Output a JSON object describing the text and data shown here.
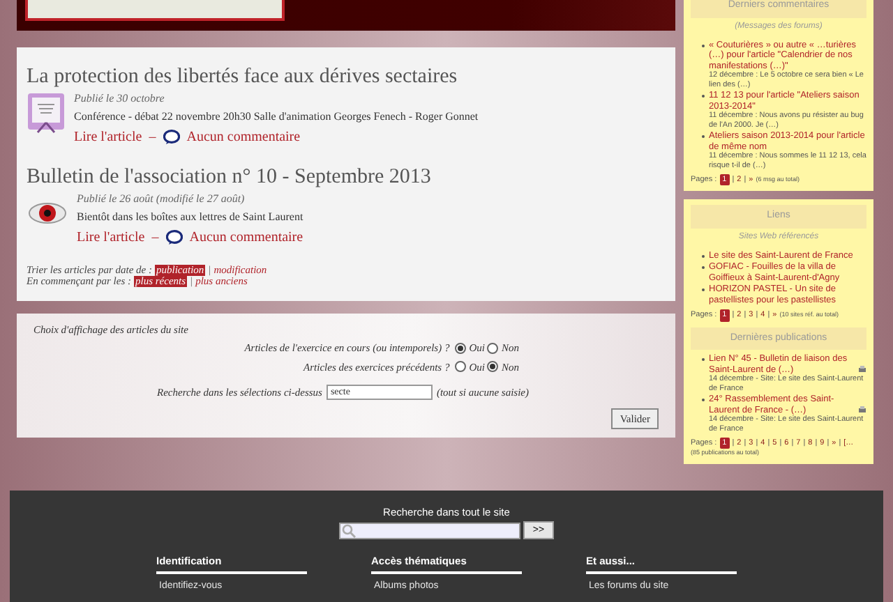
{
  "articles": [
    {
      "title": "La protection des libertés face aux dérives sectaires",
      "date": "Publié le 30 octobre",
      "summary": "Conférence - débat 22 novembre 20h30 Salle d'animation Georges Fenech - Roger Gonnet",
      "read": "Lire l'article",
      "dash": "–",
      "comments": "Aucun commentaire",
      "kind": "poster"
    },
    {
      "title": "Bulletin de l'association n° 10 - Septembre 2013",
      "date": "Publié le 26 août (modifié le 27 août)",
      "summary": "Bientôt dans les boîtes aux lettres de Saint Laurent",
      "read": "Lire l'article",
      "dash": "–",
      "comments": "Aucun commentaire",
      "kind": "eye"
    }
  ],
  "sorting": [
    {
      "label": "Trier les articles par date de :",
      "options": [
        {
          "label": "publication",
          "selected": true
        },
        {
          "label": "modification",
          "selected": false
        }
      ]
    },
    {
      "label": "En commençant par les :",
      "options": [
        {
          "label": "plus récents",
          "selected": true
        },
        {
          "label": "plus anciens",
          "selected": false
        }
      ]
    }
  ],
  "separator": "|",
  "filter": {
    "title": "Choix d'affichage des articles du site",
    "questions": [
      {
        "label": "Articles de l'exercice en cours (ou intemporels) ?",
        "options": [
          {
            "label": "Oui",
            "selected": true
          },
          {
            "label": "Non",
            "selected": false
          }
        ]
      },
      {
        "label": "Articles des exercices précédents ?",
        "options": [
          {
            "label": "Oui",
            "selected": false
          },
          {
            "label": "Non",
            "selected": true
          }
        ]
      }
    ],
    "search_label": "Recherche dans les sélections ci-dessus",
    "search_value": "secte",
    "search_hint": "(tout si aucune saisie)",
    "submit": "Valider"
  },
  "sidebar": [
    {
      "heading": "Derniers commentaires",
      "subheading": "(Messages des forums)",
      "items": [
        {
          "link": "« Couturières » ou autre « …turières (…) pour l'article \"Calendrier de nos manifestations (…)\"",
          "detail": "12 décembre : Le 5 octobre ce sera bien « Le lien des (…)"
        },
        {
          "link": "11 12 13 pour l'article \"Ateliers saison 2013-2014\"",
          "detail": "11 décembre : Nous avons pu résister au bug de l'An 2000. Je (…)"
        },
        {
          "link": "Ateliers saison 2013-2014 pour l'article de même nom",
          "detail": "11 décembre : Nous sommes le 11 12 13, cela risque t-il de (…)"
        }
      ],
      "pages_label": "Pages :",
      "pages": [
        {
          "label": "1",
          "selected": true
        },
        {
          "label": "2",
          "selected": false
        },
        {
          "label": "»",
          "selected": false
        }
      ],
      "total": "(6 msg au total)"
    },
    {
      "heading": "Liens",
      "subheading": "Sites Web référencés",
      "items": [
        {
          "link": "Le site des Saint-Laurent de France"
        },
        {
          "link": "GOFIAC - Fouilles de la villa de Goiffieux à Saint-Laurent-d'Agny"
        },
        {
          "link": "HORIZON PASTEL - Un site de pastellistes pour les pastellistes"
        }
      ],
      "pages_label": "Pages :",
      "pages": [
        {
          "label": "1",
          "selected": true
        },
        {
          "label": "2",
          "selected": false
        },
        {
          "label": "3",
          "selected": false
        },
        {
          "label": "4",
          "selected": false
        },
        {
          "label": "»",
          "selected": false
        }
      ],
      "total": "(10 sites réf. au total)"
    },
    {
      "heading": "Dernières publications",
      "items": [
        {
          "link": "Lien N° 45 - Bulletin de liaison des Saint-Laurent de (…)",
          "detail": "14 décembre - Site: Le site des Saint-Laurent de France",
          "attachment": true
        },
        {
          "link": "24° Rassemblement des Saint-Laurent de France - (…)",
          "detail": "14 décembre - Site: Le site des Saint-Laurent de France",
          "attachment": true
        }
      ],
      "pages_label": "Pages :",
      "pages": [
        {
          "label": "1",
          "selected": true
        },
        {
          "label": "2",
          "selected": false
        },
        {
          "label": "3",
          "selected": false
        },
        {
          "label": "4",
          "selected": false
        },
        {
          "label": "5",
          "selected": false
        },
        {
          "label": "6",
          "selected": false
        },
        {
          "label": "7",
          "selected": false
        },
        {
          "label": "8",
          "selected": false
        },
        {
          "label": "9",
          "selected": false
        },
        {
          "label": "»",
          "selected": false
        },
        {
          "label": "[…",
          "selected": false
        }
      ],
      "total": "(85 publications au total)"
    }
  ],
  "footer": {
    "search_label": "Recherche dans tout le site",
    "search_button": ">>",
    "columns": [
      {
        "heading": "Identification",
        "link": "Identifiez-vous"
      },
      {
        "heading": "Accès thématiques",
        "link": "Albums photos"
      },
      {
        "heading": "Et aussi...",
        "link": "Les forums du site"
      }
    ]
  }
}
